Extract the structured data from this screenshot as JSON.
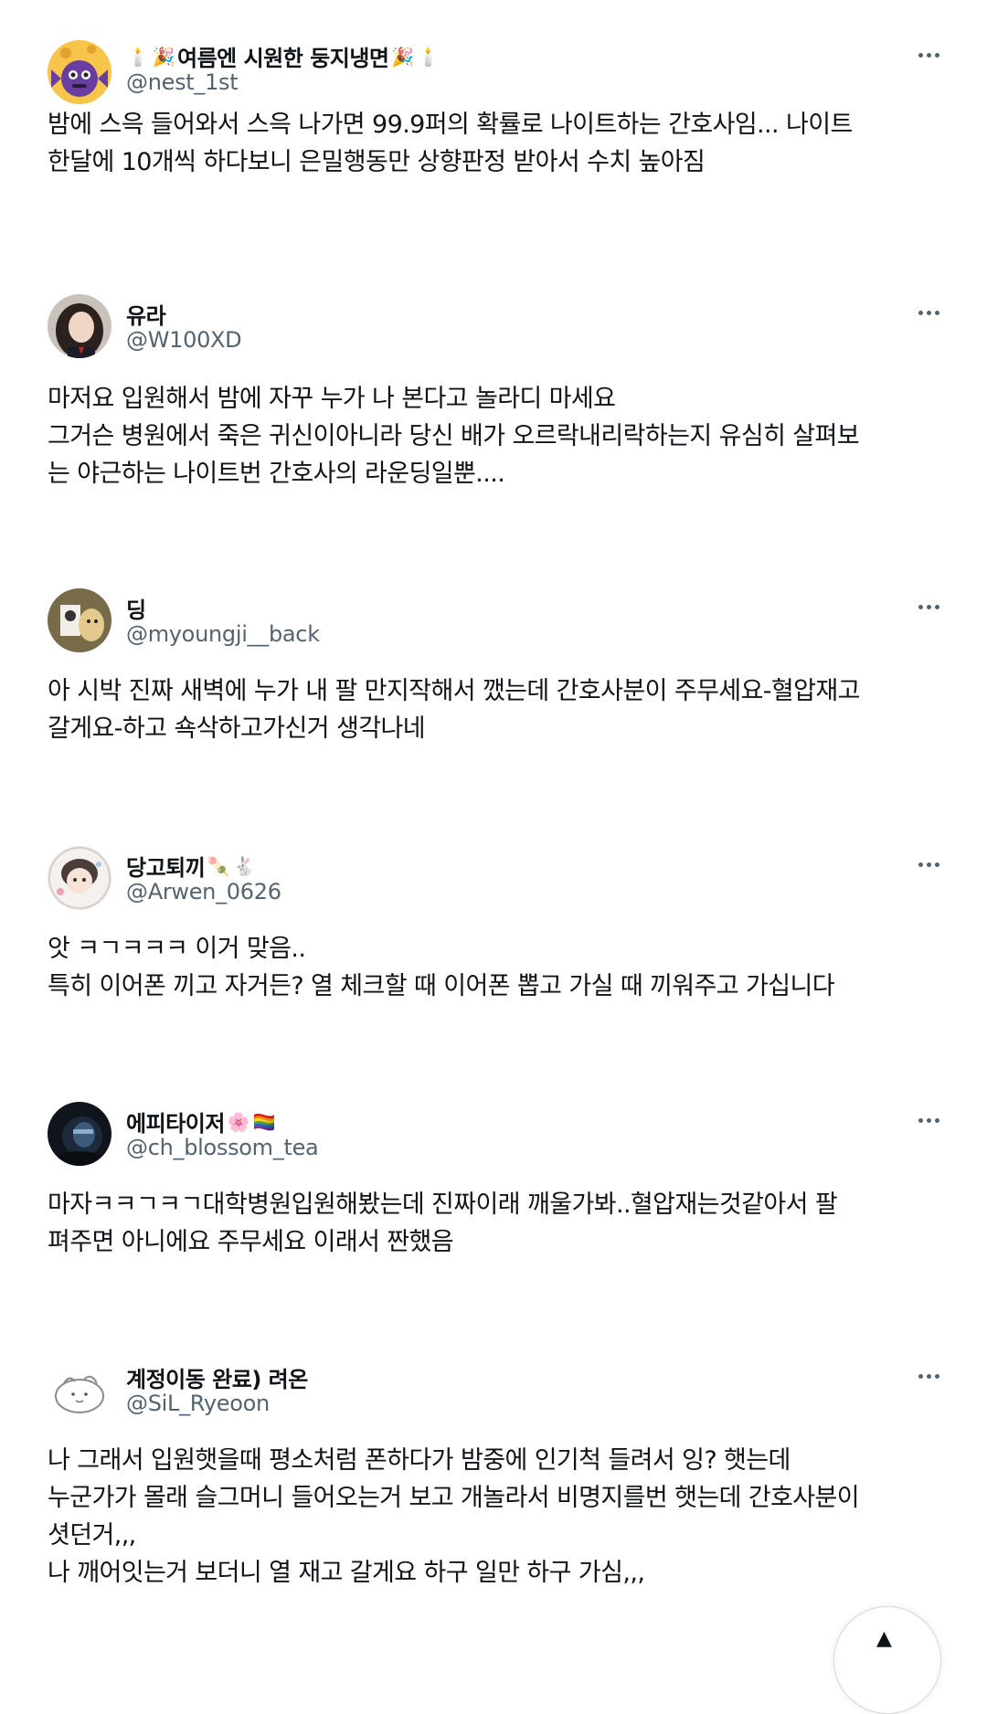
{
  "colors": {
    "text_primary": "#0f1419",
    "text_secondary": "#536471"
  },
  "tweets": [
    {
      "display_name": "여름엔 시원한 둥지냉면",
      "name_emoji_before": [
        "🕯️",
        "🎉"
      ],
      "name_emoji_after": [
        "🎉",
        "🕯️"
      ],
      "handle": "@nest_1st",
      "avatar_icon": "candy-character-avatar",
      "lines": [
        "밤에 스윽 들어와서 스윽 나가면 99.9퍼의 확률로 나이트하는 간호사임... 나이트",
        "한달에 10개씩 하다보니 은밀행동만 상향판정 받아서 수치 높아짐"
      ]
    },
    {
      "display_name": "유라",
      "name_emoji_before": [],
      "name_emoji_after": [],
      "handle": "@W100XD",
      "avatar_icon": "person-photo-avatar",
      "lines": [
        "마저요 입원해서 밤에 자꾸 누가 나 본다고 놀라디 마세요",
        "그거슨 병원에서 죽은 귀신이아니라 당신 배가 오르락내리락하는지 유심히 살펴보",
        "는 야근하는 나이트번 간호사의 라운딩일뿐...."
      ]
    },
    {
      "display_name": "딩",
      "name_emoji_before": [],
      "name_emoji_after": [],
      "handle": "@myoungji__back",
      "avatar_icon": "drawing-avatar",
      "lines": [
        "아 시박 진짜 새벽에 누가 내 팔 만지작해서 깼는데 간호사분이 주무세요-혈압재고",
        "갈게요-하고 쇽삭하고가신거 생각나네"
      ]
    },
    {
      "display_name": "당고퇴끼",
      "name_emoji_before": [],
      "name_emoji_after": [
        "🍡",
        "🐇"
      ],
      "handle": "@Arwen_0626",
      "avatar_icon": "anime-character-avatar",
      "lines": [
        "앗 ㅋㄱㅋㅋㅋ 이거 맞음..",
        "특히 이어폰 끼고 자거든? 열 체크할 때 이어폰 뽑고 가실 때 끼워주고 가십니다"
      ]
    },
    {
      "display_name": "에피타이저",
      "name_emoji_before": [],
      "name_emoji_after": [
        "🌸",
        "🏳️‍🌈"
      ],
      "handle": "@ch_blossom_tea",
      "avatar_icon": "dark-character-avatar",
      "lines": [
        "마자ㅋㅋㄱㅋㄱ대학병원입원해봤는데 진짜이래 깨울가봐..혈압재는것같아서 팔",
        "펴주면 아니에요 주무세요 이래서 짠했음"
      ]
    },
    {
      "display_name": "계정이동 완료) 려온",
      "name_emoji_before": [],
      "name_emoji_after": [],
      "handle": "@SiL_Ryeoon",
      "avatar_icon": "sketch-avatar",
      "lines": [
        "나 그래서 입원햇을때 평소처럼 폰하다가 밤중에 인기척 들려서 잉? 햇는데",
        "누군가가 몰래 슬그머니 들어오는거 보고 개놀라서 비명지를번 햇는데 간호사분이",
        "셧던거,,,",
        "나 깨어잇는거 보더니 열 재고 갈게요 하구 일만 하구 가심,,,"
      ]
    }
  ]
}
